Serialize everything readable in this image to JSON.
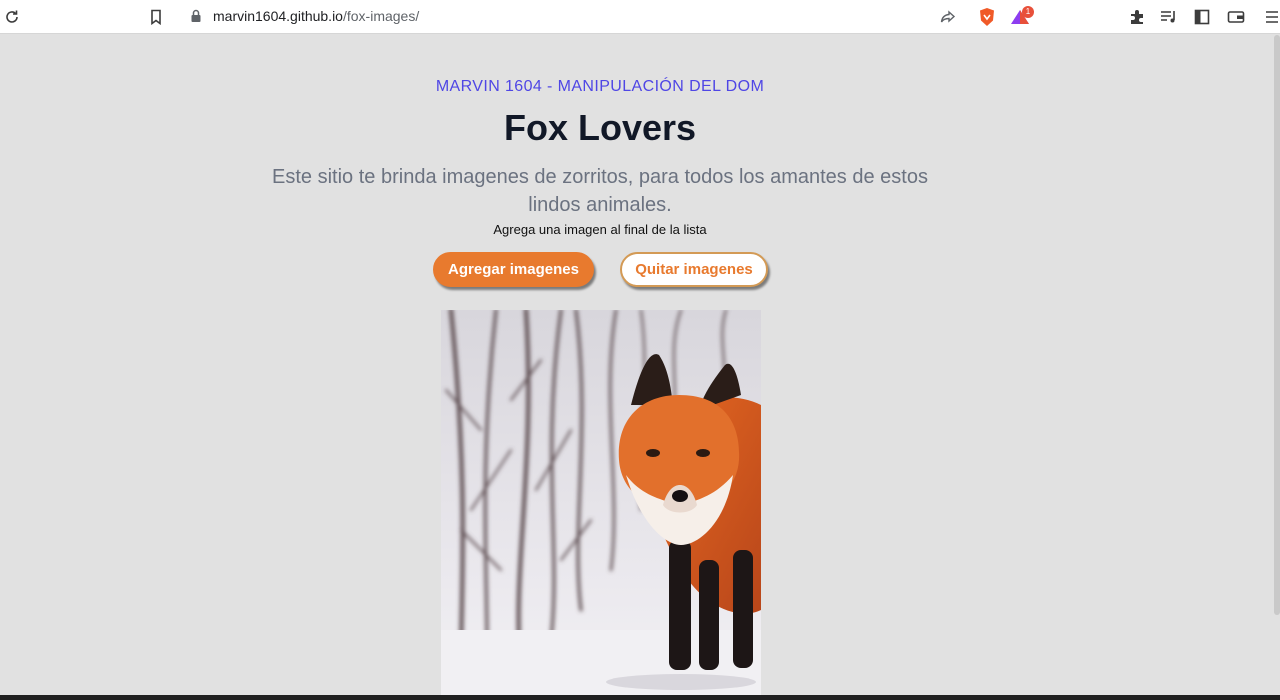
{
  "browser": {
    "url_host": "marvin1604.github.io",
    "url_path": "/fox-images/",
    "notification_count": "1",
    "icons": [
      "reload-icon",
      "bookmark-icon",
      "lock-icon",
      "share-icon",
      "brave-shield-icon",
      "brave-rewards-icon",
      "extensions-icon",
      "playlist-icon",
      "sidebar-icon",
      "wallet-icon",
      "menu-icon"
    ]
  },
  "page": {
    "eyebrow": "MARVIN 1604 - MANIPULACIÓN DEL DOM",
    "title": "Fox Lovers",
    "subtitle": "Este sitio te brinda imagenes de zorritos, para todos los amantes de estos lindos animales.",
    "hint": "Agrega una imagen al final de la lista",
    "add_button": "Agregar imagenes",
    "remove_button": "Quitar imagenes",
    "image_subject": "red-fox-in-snow"
  },
  "colors": {
    "background": "#e1e1e1",
    "accent": "#e87a2e",
    "eyebrow": "#4f46e5",
    "title": "#111827",
    "subtitle": "#6b7280"
  }
}
